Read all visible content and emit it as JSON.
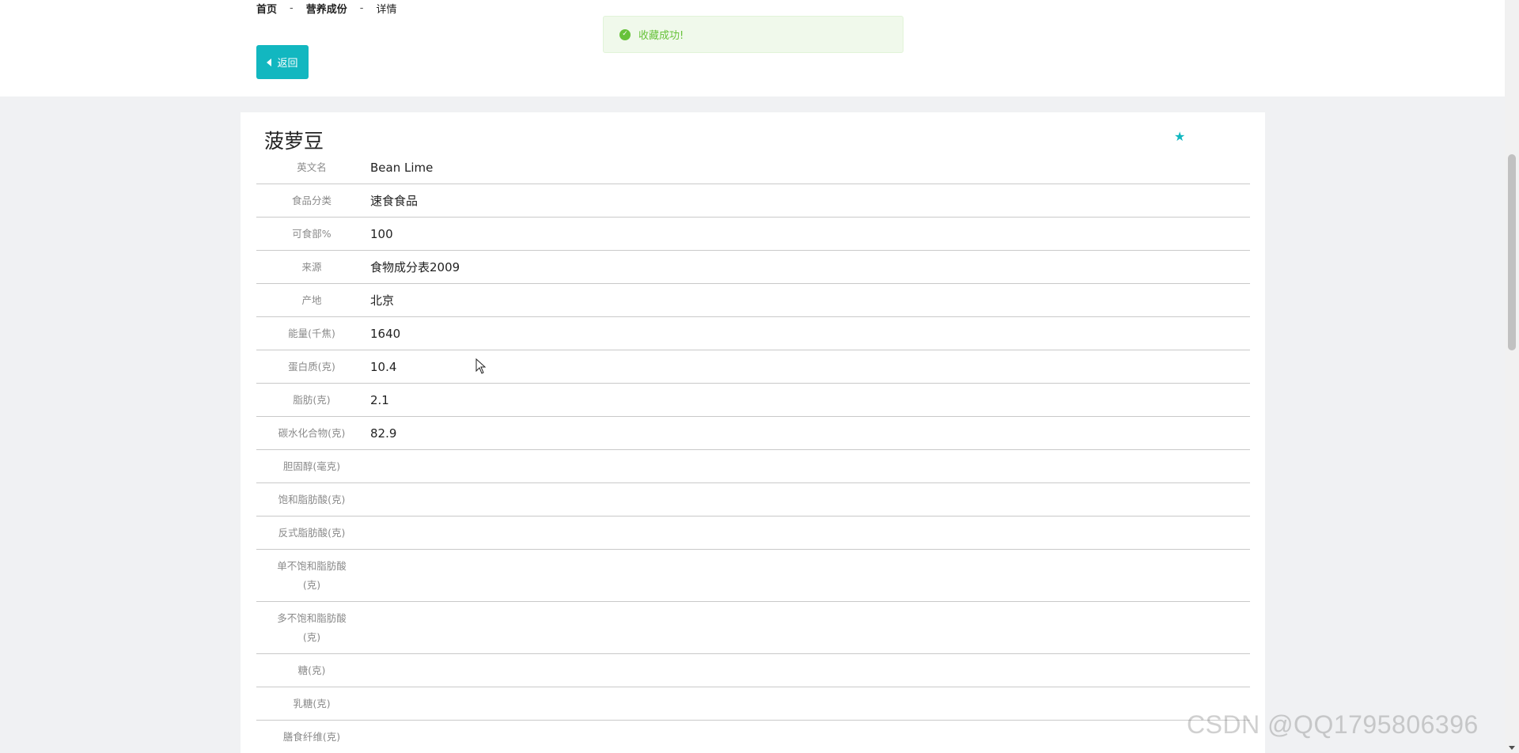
{
  "breadcrumb": {
    "items": [
      "首页",
      "营养成份",
      "详情"
    ],
    "separator": "-"
  },
  "back_button": {
    "label": "返回",
    "icon": "caret-left-icon"
  },
  "toast": {
    "message": "收藏成功!",
    "icon": "check-circle-icon",
    "color": "#67c23a"
  },
  "detail": {
    "title": "菠萝豆",
    "favorite_icon": "star-icon",
    "rows": [
      {
        "label": "英文名",
        "value": "Bean Lime"
      },
      {
        "label": "食品分类",
        "value": "速食食品"
      },
      {
        "label": "可食部%",
        "value": "100"
      },
      {
        "label": "来源",
        "value": "食物成分表2009"
      },
      {
        "label": "产地",
        "value": "北京"
      },
      {
        "label": "能量(千焦)",
        "value": "1640"
      },
      {
        "label": "蛋白质(克)",
        "value": "10.4"
      },
      {
        "label": "脂肪(克)",
        "value": "2.1"
      },
      {
        "label": "碳水化合物(克)",
        "value": "82.9"
      },
      {
        "label": "胆固醇(毫克)",
        "value": ""
      },
      {
        "label": "饱和脂肪酸(克)",
        "value": ""
      },
      {
        "label": "反式脂肪酸(克)",
        "value": ""
      },
      {
        "label": "单不饱和脂肪酸(克)",
        "value": ""
      },
      {
        "label": "多不饱和脂肪酸(克)",
        "value": ""
      },
      {
        "label": "糖(克)",
        "value": ""
      },
      {
        "label": "乳糖(克)",
        "value": ""
      },
      {
        "label": "膳食纤维(克)",
        "value": ""
      }
    ]
  },
  "watermark": "CSDN @QQ1795806396",
  "colors": {
    "accent": "#12b7c0",
    "page_bg": "#f0f1f3"
  }
}
